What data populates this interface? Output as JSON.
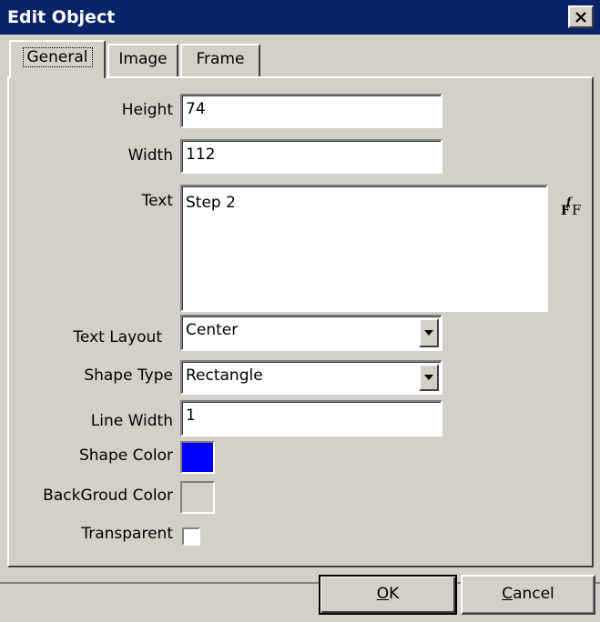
{
  "window": {
    "title": "Edit Object"
  },
  "tabs": [
    {
      "label": "General",
      "active": true
    },
    {
      "label": "Image",
      "active": false
    },
    {
      "label": "Frame",
      "active": false
    }
  ],
  "form": {
    "height": {
      "label": "Height",
      "value": "74"
    },
    "width": {
      "label": "Width",
      "value": "112"
    },
    "text": {
      "label": "Text",
      "value": "Step 2"
    },
    "text_layout": {
      "label": "Text Layout",
      "value": "Center"
    },
    "shape_type": {
      "label": "Shape Type",
      "value": "Rectangle"
    },
    "line_width": {
      "label": "Line Width",
      "value": "1"
    },
    "shape_color": {
      "label": "Shape Color",
      "color": "#0000ff"
    },
    "background_color": {
      "label": "BackGroud Color",
      "color": "#d4d0c8"
    },
    "transparent": {
      "label": "Transparent",
      "checked": false
    }
  },
  "buttons": {
    "ok": {
      "mnemonic": "O",
      "rest": "K"
    },
    "cancel": {
      "mnemonic": "C",
      "rest": "ancel"
    }
  },
  "icons": {
    "close": "close-icon",
    "font": "font-icon",
    "dropdown": "chevron-down-icon"
  },
  "colors": {
    "titlebar": "#0a246a",
    "face": "#d4d0c8"
  }
}
